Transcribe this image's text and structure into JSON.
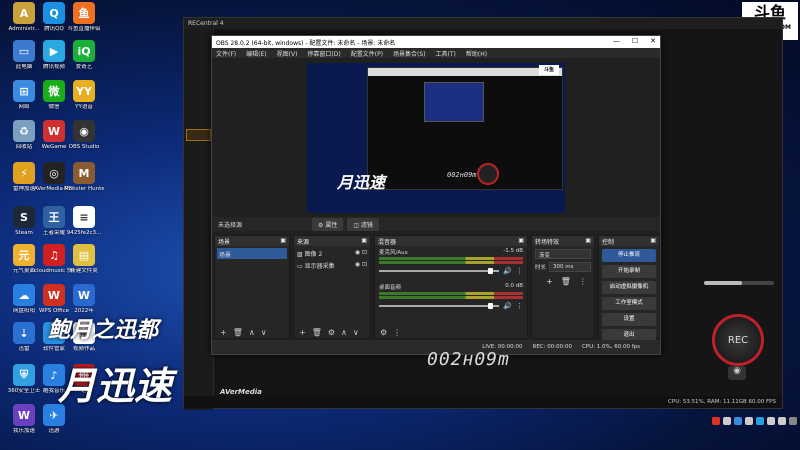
{
  "desktop": {
    "icons": [
      {
        "label": "Administr...",
        "color": "#c9a23a",
        "glyph": "A",
        "name": "folder-icon"
      },
      {
        "label": "腾讯QQ",
        "color": "#1b8fe0",
        "glyph": "Q",
        "name": "qq-icon"
      },
      {
        "label": "斗鱼直播伴侣",
        "color": "#f07020",
        "glyph": "鱼",
        "name": "douyu-icon"
      },
      {
        "label": "此电脑",
        "color": "#3a7ad0",
        "glyph": "▭",
        "name": "computer-icon"
      },
      {
        "label": "腾讯视频",
        "color": "#2aa8e0",
        "glyph": "▶",
        "name": "tencent-video-icon"
      },
      {
        "label": "爱奇艺",
        "color": "#19b03a",
        "glyph": "iQ",
        "name": "iqiyi-icon"
      },
      {
        "label": "网络",
        "color": "#3a8ae0",
        "glyph": "⊞",
        "name": "network-icon"
      },
      {
        "label": "微信",
        "color": "#1aad19",
        "glyph": "微",
        "name": "wechat-icon"
      },
      {
        "label": "YY语音",
        "color": "#e8b020",
        "glyph": "YY",
        "name": "yy-icon"
      },
      {
        "label": "回收站",
        "color": "#7aa0c0",
        "glyph": "♻",
        "name": "recycle-bin-icon"
      },
      {
        "label": "WeGame",
        "color": "#d03030",
        "glyph": "W",
        "name": "wegame-icon"
      },
      {
        "label": "OBS Studio",
        "color": "#333333",
        "glyph": "◉",
        "name": "obs-icon"
      },
      {
        "label": "雷神加速",
        "color": "#e0a020",
        "glyph": "⚡",
        "name": "leishen-icon"
      },
      {
        "label": "AVerMedia RECentral 4",
        "color": "#222222",
        "glyph": "◎",
        "name": "recentral-icon"
      },
      {
        "label": "Monster Hunter...",
        "color": "#8a5a30",
        "glyph": "M",
        "name": "monster-hunter-icon"
      },
      {
        "label": "Steam",
        "color": "#1b2838",
        "glyph": "S",
        "name": "steam-icon"
      },
      {
        "label": "王者荣耀",
        "color": "#3060a0",
        "glyph": "王",
        "name": "game-icon"
      },
      {
        "label": "9425fe2c3...",
        "color": "#ffffff",
        "glyph": "≡",
        "name": "file-icon"
      },
      {
        "label": "元气桌面",
        "color": "#f0b030",
        "glyph": "元",
        "name": "yuanqi-icon"
      },
      {
        "label": "cloudmusic 快捷方式",
        "color": "#d02020",
        "glyph": "♫",
        "name": "cloudmusic-icon"
      },
      {
        "label": "新建文件夹",
        "color": "#e0c040",
        "glyph": "▤",
        "name": "folder-new-icon"
      },
      {
        "label": "网盘阳阳",
        "color": "#2a80e0",
        "glyph": "☁",
        "name": "netdisk-icon"
      },
      {
        "label": "WPS Office",
        "color": "#d03020",
        "glyph": "W",
        "name": "wps-icon"
      },
      {
        "label": "2022年",
        "color": "#2a6ad0",
        "glyph": "W",
        "name": "word-doc-icon"
      },
      {
        "label": "迅雷",
        "color": "#2a70d0",
        "glyph": "⇣",
        "name": "xunlei-icon"
      },
      {
        "label": "软件管家",
        "color": "#2a90e0",
        "glyph": "◆",
        "name": "software-manager-icon"
      },
      {
        "label": "视频作品",
        "color": "#ffffff",
        "glyph": "▦",
        "name": "video-folder-icon"
      },
      {
        "label": "360安全卫士",
        "color": "#30a0e0",
        "glyph": "⛨",
        "name": "security-icon"
      },
      {
        "label": "酷我音乐",
        "color": "#2a80e0",
        "glyph": "♪",
        "name": "kuwo-icon"
      },
      {
        "label": "班",
        "color": "#c02020",
        "glyph": "班",
        "name": "app-icon"
      },
      {
        "label": "我乐加速",
        "color": "#6a40c0",
        "glyph": "W",
        "name": "wole-icon"
      },
      {
        "label": "迅游",
        "color": "#2a80e0",
        "glyph": "✈",
        "name": "xunyou-icon"
      }
    ]
  },
  "recentral": {
    "title": "RECentral 4",
    "brand": "AVerMedia",
    "rec_label": "REC",
    "status": "CPU: 53.51%, RAM: 11.11GB 60.00 FPS",
    "timer": "002н09m"
  },
  "douyu": {
    "logo": "斗鱼",
    "domain": "DOUYU.COM"
  },
  "obs": {
    "title": "OBS 28.0.2 (64-bit, windows) - 配置文件: 未命名 - 场景: 未命名",
    "menu": [
      "文件(F)",
      "编辑(E)",
      "视图(V)",
      "停靠窗口(D)",
      "配置文件(P)",
      "场景集合(S)",
      "工具(T)",
      "帮助(H)"
    ],
    "context": {
      "no_source": "未选择源",
      "properties": "属性",
      "filters": "滤镜"
    },
    "docks": {
      "scenes": {
        "title": "场景",
        "items": [
          "场景"
        ]
      },
      "sources": {
        "title": "来源",
        "items": [
          "图像 2",
          "显示器采集"
        ]
      },
      "mixer": {
        "title": "混音器",
        "channels": [
          {
            "name": "麦克风/Aux",
            "db": "-1.5 dB"
          },
          {
            "name": "桌面音频",
            "db": "0.0 dB"
          }
        ]
      },
      "transitions": {
        "title": "转场特效",
        "type": "渐变",
        "duration_label": "时长",
        "duration": "300 ms"
      },
      "controls": {
        "title": "控制",
        "buttons": [
          "停止推流",
          "开始录制",
          "启动虚拟摄像机",
          "工作室模式",
          "设置",
          "退出"
        ]
      }
    },
    "status": {
      "live": "LIVE: 00:00:00",
      "rec": "REC: 00:00:00",
      "cpu": "CPU: 1.0%, 60.00 fps"
    }
  },
  "overlay": {
    "text1": "鲍月之迅都",
    "text2": "月迅速"
  }
}
